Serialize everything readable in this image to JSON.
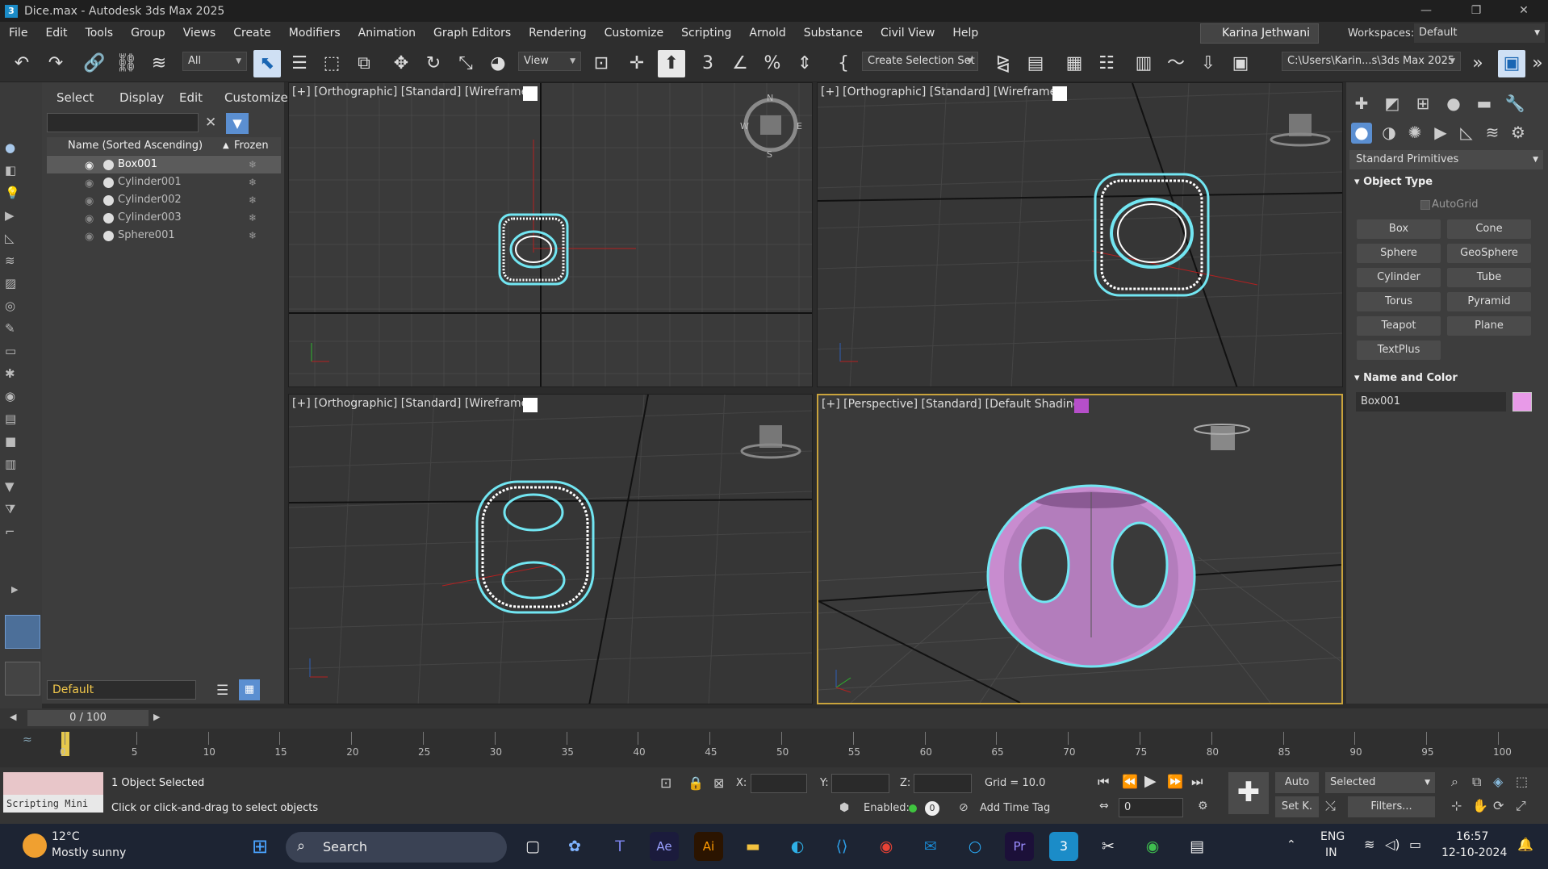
{
  "window": {
    "title": "Dice.max - Autodesk 3ds Max 2025",
    "min": "—",
    "max": "❐",
    "close": "✕"
  },
  "menu": [
    "File",
    "Edit",
    "Tools",
    "Group",
    "Views",
    "Create",
    "Modifiers",
    "Animation",
    "Graph Editors",
    "Rendering",
    "Customize",
    "Scripting",
    "Arnold",
    "Substance",
    "Civil View",
    "Help"
  ],
  "user": {
    "name": "Karina Jethwani",
    "workspaces_label": "Workspaces:",
    "workspace": "Default"
  },
  "toolbar": {
    "filter": "All",
    "refcoord": "View",
    "selset": "Create Selection Set",
    "path": "C:\\Users\\Karin...s\\3ds Max 2025"
  },
  "scene_explorer": {
    "menus": [
      "Select",
      "Display",
      "Edit",
      "Customize"
    ],
    "col_name": "Name (Sorted Ascending)",
    "col_frozen": "Frozen",
    "rows": [
      "Box001",
      "Cylinder001",
      "Cylinder002",
      "Cylinder003",
      "Sphere001"
    ],
    "layer": "Default"
  },
  "viewports": {
    "top": "[+] [Orthographic] [Standard] [Wireframe]",
    "front": "[+] [Orthographic] [Standard] [Wireframe]",
    "left": "[+] [Orthographic] [Standard] [Wireframe]",
    "persp": "[+] [Perspective] [Standard] [Default Shading]"
  },
  "command_panel": {
    "category": "Standard Primitives",
    "object_type": "Object Type",
    "autogrid": "AutoGrid",
    "buttons": [
      "Box",
      "Cone",
      "Sphere",
      "GeoSphere",
      "Cylinder",
      "Tube",
      "Torus",
      "Pyramid",
      "Teapot",
      "Plane",
      "TextPlus"
    ],
    "name_color": "Name and Color",
    "name": "Box001",
    "color": "#e89ae8"
  },
  "timeline": {
    "frame": "0 / 100",
    "ticks": [
      "0",
      "5",
      "10",
      "15",
      "20",
      "25",
      "30",
      "35",
      "40",
      "45",
      "50",
      "55",
      "60",
      "65",
      "70",
      "75",
      "80",
      "85",
      "90",
      "95",
      "100"
    ]
  },
  "status": {
    "listener": "Scripting Mini",
    "selected": "1 Object Selected",
    "prompt": "Click or click-and-drag to select objects",
    "x": "X:",
    "y": "Y:",
    "z": "Z:",
    "grid": "Grid = 10.0",
    "enabled": "Enabled:",
    "add_time_tag": "Add Time Tag",
    "auto": "Auto",
    "selected_drop": "Selected",
    "setk": "Set K.",
    "filters": "Filters...",
    "frame_spinner": "0"
  },
  "taskbar": {
    "temp": "12°C",
    "weather": "Mostly sunny",
    "search": "Search",
    "lang1": "ENG",
    "lang2": "IN",
    "time": "16:57",
    "date": "12-10-2024"
  }
}
